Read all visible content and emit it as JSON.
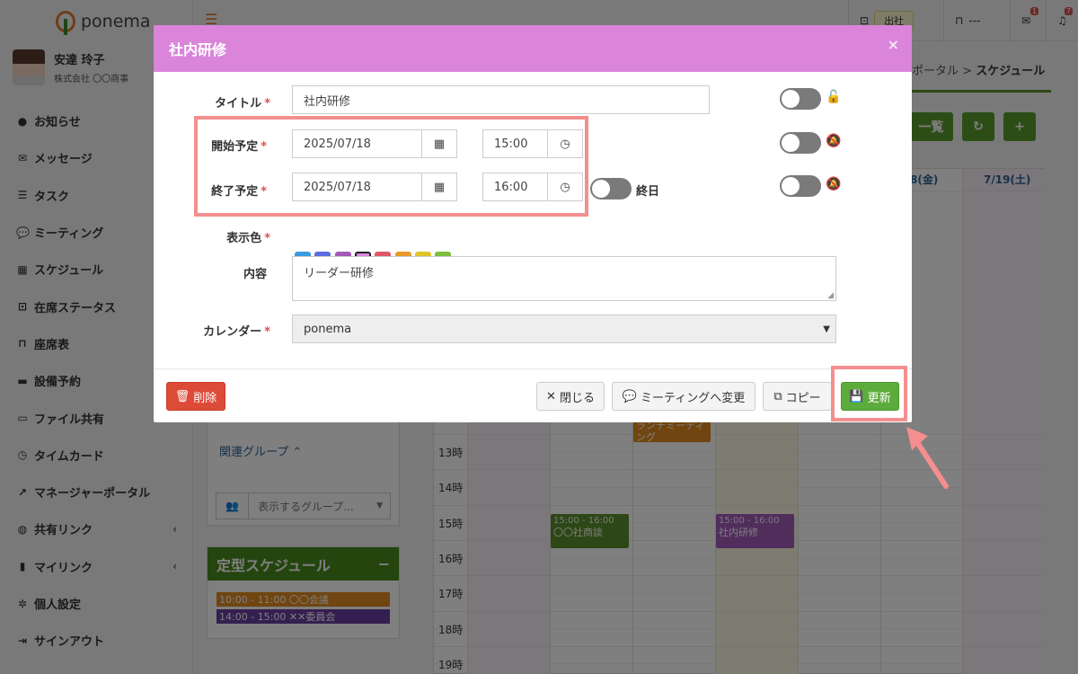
{
  "app": {
    "logo": "ponema"
  },
  "user": {
    "name": "安達 玲子",
    "company": "株式会社 〇〇商事"
  },
  "sidebar": {
    "items": [
      {
        "label": "お知らせ",
        "icon": "info-icon",
        "glyph": "●"
      },
      {
        "label": "メッセージ",
        "icon": "envelope-icon",
        "glyph": "✉"
      },
      {
        "label": "タスク",
        "icon": "tasks-icon",
        "glyph": "☰"
      },
      {
        "label": "ミーティング",
        "icon": "comments-icon",
        "glyph": "💬"
      },
      {
        "label": "スケジュール",
        "icon": "calendar-icon",
        "glyph": "▦"
      },
      {
        "label": "在席ステータス",
        "icon": "presence-icon",
        "glyph": "⊡"
      },
      {
        "label": "座席表",
        "icon": "chair-icon",
        "glyph": "⊓"
      },
      {
        "label": "設備予約",
        "icon": "equipment-icon",
        "glyph": "▬"
      },
      {
        "label": "ファイル共有",
        "icon": "folder-icon",
        "glyph": "▭"
      },
      {
        "label": "タイムカード",
        "icon": "clock-icon",
        "glyph": "◷"
      },
      {
        "label": "マネージャーポータル",
        "icon": "chart-icon",
        "glyph": "↗"
      },
      {
        "label": "共有リンク",
        "icon": "globe-icon",
        "glyph": "◍",
        "chevron": "‹"
      },
      {
        "label": "マイリンク",
        "icon": "bookmark-icon",
        "glyph": "▮",
        "chevron": "‹"
      },
      {
        "label": "個人設定",
        "icon": "cog-icon",
        "glyph": "✲"
      },
      {
        "label": "サインアウト",
        "icon": "sign-out-icon",
        "glyph": "⇥"
      }
    ]
  },
  "topbar": {
    "status_label": "出社",
    "seat_label": "---",
    "mail_badge": "1",
    "bell_badge": "7"
  },
  "breadcrumb": {
    "parent": "ポータル",
    "sep": ">",
    "current": "スケジュール"
  },
  "page_buttons": {
    "list_label": "一覧"
  },
  "calendar": {
    "days": [
      "8(金)",
      "7/19(土)"
    ],
    "hours": [
      "13時",
      "14時",
      "15時",
      "16時",
      "17時",
      "18時",
      "19時"
    ],
    "events": [
      {
        "time": "",
        "title": "ランチミーティング",
        "color": "#e08a1e"
      },
      {
        "time": "15:00 - 16:00",
        "title": "〇〇社商談",
        "color": "#5b8f2c"
      },
      {
        "time": "15:00 - 16:00",
        "title": "社内研修",
        "color": "#a35ab8"
      }
    ]
  },
  "side_panel": {
    "related_group": "関連グループ",
    "group_select_placeholder": "表示するグループ..."
  },
  "teikei": {
    "title": "定型スケジュール",
    "items": [
      {
        "label": "10:00 - 11:00  〇〇会議",
        "color": "#e08a1e"
      },
      {
        "label": "14:00 - 15:00  ✕✕委員会",
        "color": "#6a3fa0"
      }
    ]
  },
  "modal": {
    "title": "社内研修",
    "title_label": "タイトル",
    "title_value": "社内研修",
    "start_label": "開始予定",
    "start_date": "2025/07/18",
    "start_time": "15:00",
    "end_label": "終了予定",
    "end_date": "2025/07/18",
    "end_time": "16:00",
    "allday_label": "終日",
    "color_label": "表示色",
    "colors": [
      "#3a9be0",
      "#5b6ee0",
      "#a35ab8",
      "#da85da",
      "#e0576b",
      "#e89a2a",
      "#e0c42a",
      "#7bbf3a"
    ],
    "selected_color": "#da85da",
    "content_label": "内容",
    "content_value": "リーダー研修",
    "calendar_label": "カレンダー",
    "calendar_value": "ponema",
    "required_mark": "*",
    "delete_label": "削除",
    "close_label": "閉じる",
    "to_meeting_label": "ミーティングへ変更",
    "copy_label": "コピー",
    "update_label": "更新"
  }
}
